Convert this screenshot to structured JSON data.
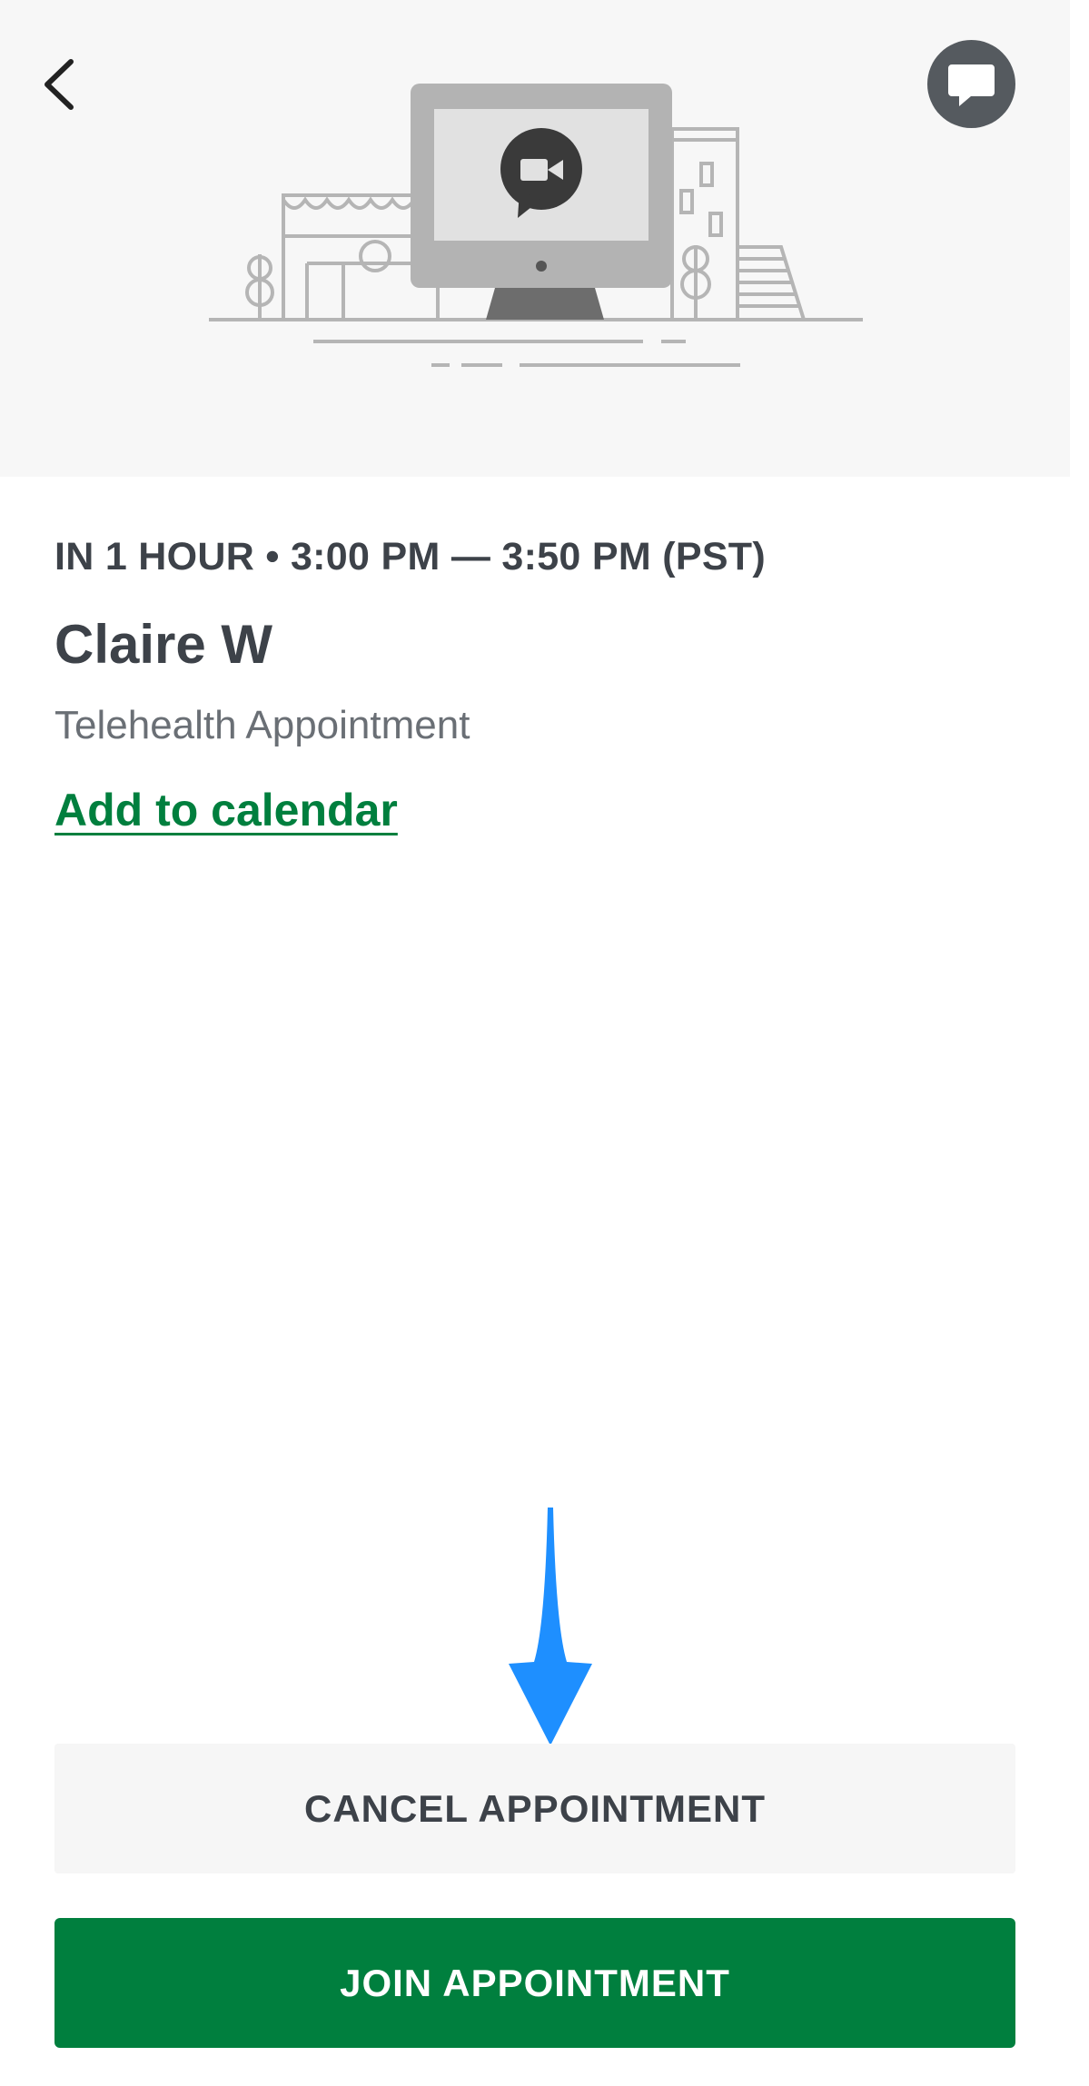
{
  "header": {
    "back_icon": "chevron-left-icon",
    "chat_icon": "chat-bubble-icon",
    "illustration": "telehealth-monitor-illustration"
  },
  "appointment": {
    "time_line": "IN 1 HOUR • 3:00 PM — 3:50 PM (PST)",
    "provider_name": "Claire W",
    "type": "Telehealth Appointment",
    "add_to_calendar_label": "Add to calendar"
  },
  "actions": {
    "cancel_label": "CANCEL APPOINTMENT",
    "join_label": "JOIN APPOINTMENT"
  },
  "colors": {
    "brand_green": "#007f3e",
    "text_dark": "#3d4249",
    "text_muted": "#6a6f75",
    "hero_bg": "#f7f7f7",
    "annotation_arrow": "#1e8fff"
  }
}
